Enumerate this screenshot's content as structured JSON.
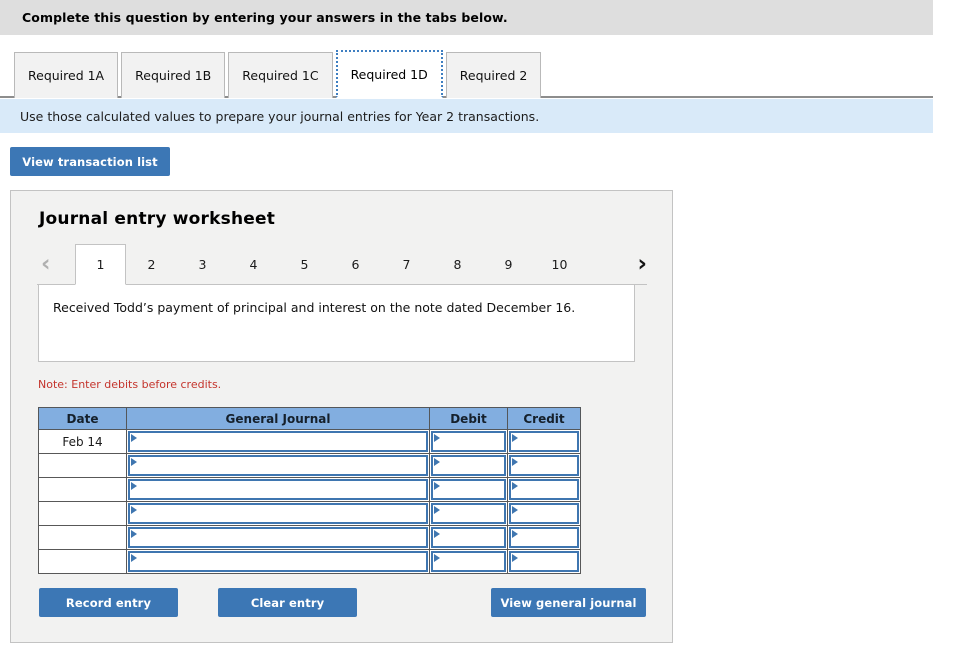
{
  "header": {
    "instruction": "Complete this question by entering your answers in the tabs below."
  },
  "tabs": [
    {
      "label": "Required 1A",
      "active": false
    },
    {
      "label": "Required 1B",
      "active": false
    },
    {
      "label": "Required 1C",
      "active": false
    },
    {
      "label": "Required 1D",
      "active": true
    },
    {
      "label": "Required 2",
      "active": false
    }
  ],
  "banner": {
    "text": "Use those calculated values to prepare your journal entries for Year 2 transactions."
  },
  "toolbar": {
    "view_transaction_list_label": "View transaction list"
  },
  "worksheet": {
    "title": "Journal entry worksheet",
    "pager": {
      "prev_icon": "chevron-left-icon",
      "next_icon": "chevron-right-icon",
      "prev_glyph": "‹",
      "next_glyph": "›",
      "pages": [
        "1",
        "2",
        "3",
        "4",
        "5",
        "6",
        "7",
        "8",
        "9",
        "10"
      ],
      "active_page": "1"
    },
    "description": "Received Todd’s payment of principal and interest on the note dated December 16.",
    "note": "Note: Enter debits before credits.",
    "table": {
      "columns": [
        "Date",
        "General Journal",
        "Debit",
        "Credit"
      ],
      "rows": [
        {
          "date": "Feb 14",
          "general_journal": "",
          "debit": "",
          "credit": ""
        },
        {
          "date": "",
          "general_journal": "",
          "debit": "",
          "credit": ""
        },
        {
          "date": "",
          "general_journal": "",
          "debit": "",
          "credit": ""
        },
        {
          "date": "",
          "general_journal": "",
          "debit": "",
          "credit": ""
        },
        {
          "date": "",
          "general_journal": "",
          "debit": "",
          "credit": ""
        },
        {
          "date": "",
          "general_journal": "",
          "debit": "",
          "credit": ""
        }
      ]
    },
    "buttons": {
      "record_entry": "Record entry",
      "clear_entry": "Clear entry",
      "view_general_journal": "View general journal"
    }
  },
  "colors": {
    "header_bar": "#dedede",
    "banner": "#d9eaf9",
    "button_blue": "#3c77b5",
    "table_header_blue": "#82aee0",
    "note_red": "#c4342c",
    "panel_bg": "#f2f2f1",
    "active_tab_border": "#3f7fc1"
  }
}
